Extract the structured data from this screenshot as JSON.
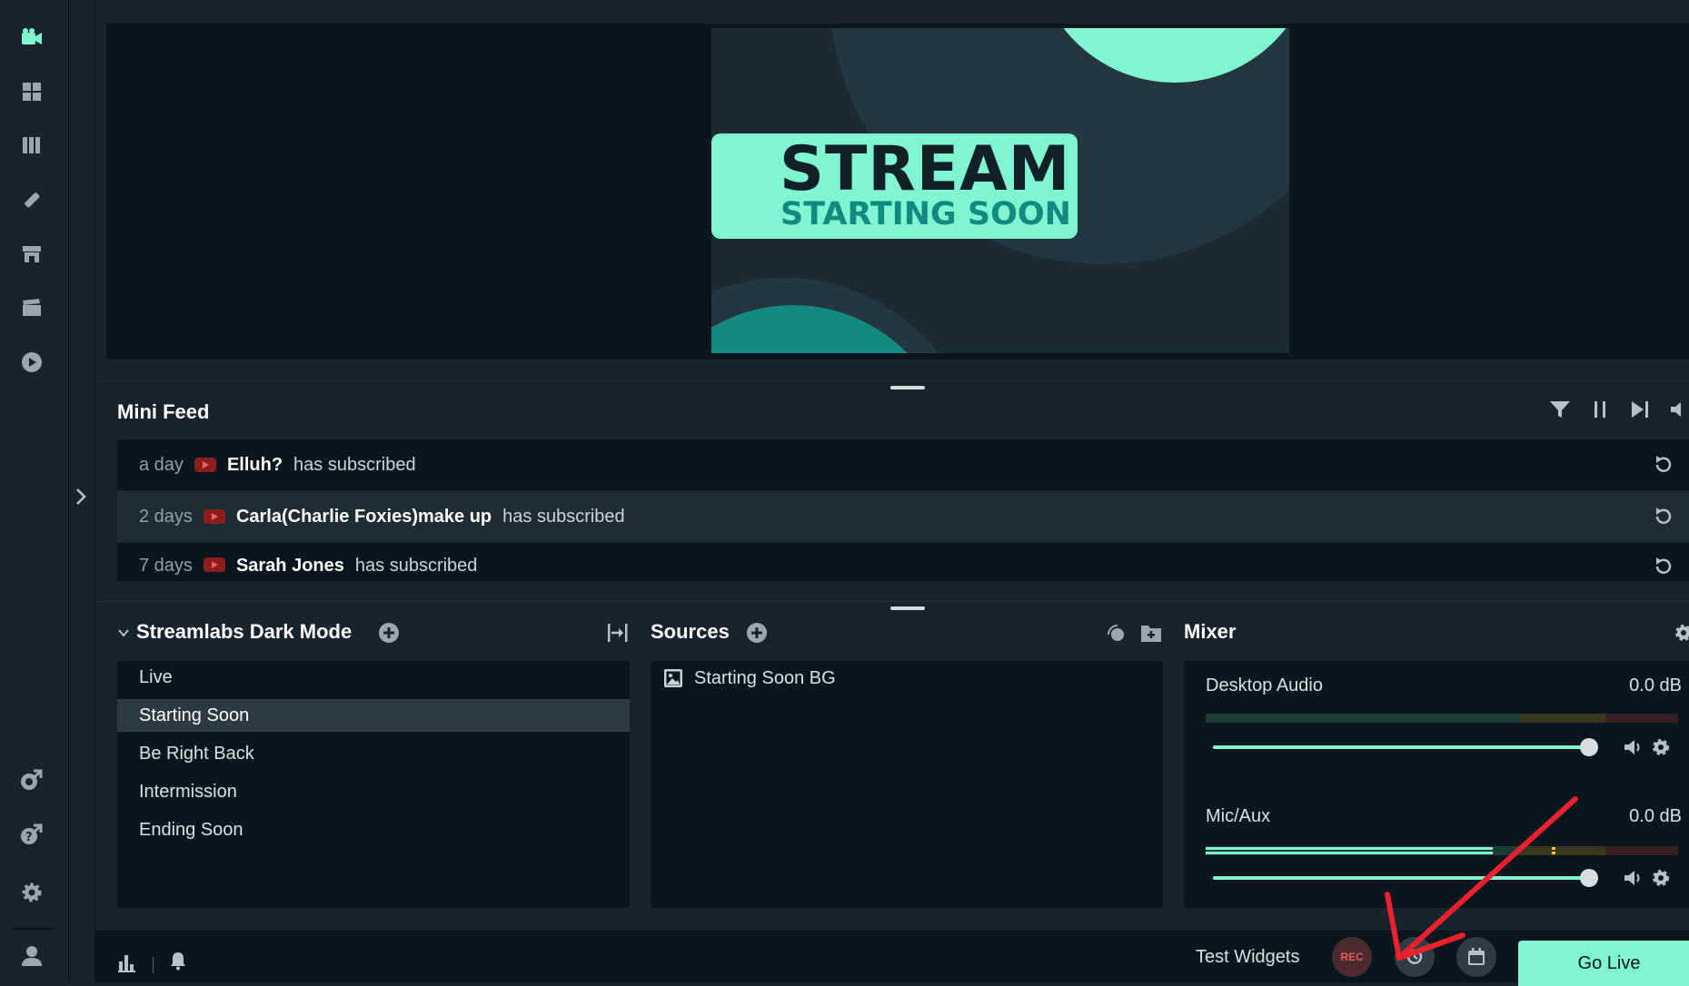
{
  "rail": {
    "icons": [
      "studio-icon",
      "dashboard-icon",
      "library-icon",
      "themes-icon",
      "store-icon",
      "media-icon",
      "highlighter-icon",
      "cloud-link-icon",
      "help-icon",
      "settings-icon",
      "profile-icon"
    ]
  },
  "preview": {
    "scene_title_main": "STREAM",
    "scene_title_sub": "STARTING SOON",
    "colors": {
      "accent": "#80f5d2",
      "dark": "#1a2b33",
      "teal": "#138a80"
    }
  },
  "minifeed": {
    "title": "Mini Feed",
    "items": [
      {
        "time": "a day",
        "name": "Elluh?",
        "message": "has subscribed"
      },
      {
        "time": "2 days",
        "name": "Carla(Charlie Foxies)make up",
        "message": "has subscribed"
      },
      {
        "time": "7 days",
        "name": "Sarah Jones",
        "message": "has subscribed"
      }
    ]
  },
  "scenes": {
    "title": "Streamlabs Dark Mode",
    "items": [
      "Live",
      "Starting Soon",
      "Be Right Back",
      "Intermission",
      "Ending Soon"
    ],
    "active": "Starting Soon"
  },
  "sources": {
    "title": "Sources",
    "items": [
      "Starting Soon BG"
    ]
  },
  "mixer": {
    "title": "Mixer",
    "channels": [
      {
        "name": "Desktop Audio",
        "db": "0.0 dB",
        "level": 0
      },
      {
        "name": "Mic/Aux",
        "db": "0.0 dB",
        "level": 0.6
      }
    ]
  },
  "footer": {
    "test_widgets": "Test Widgets",
    "rec": "REC",
    "go_live": "Go Live"
  }
}
